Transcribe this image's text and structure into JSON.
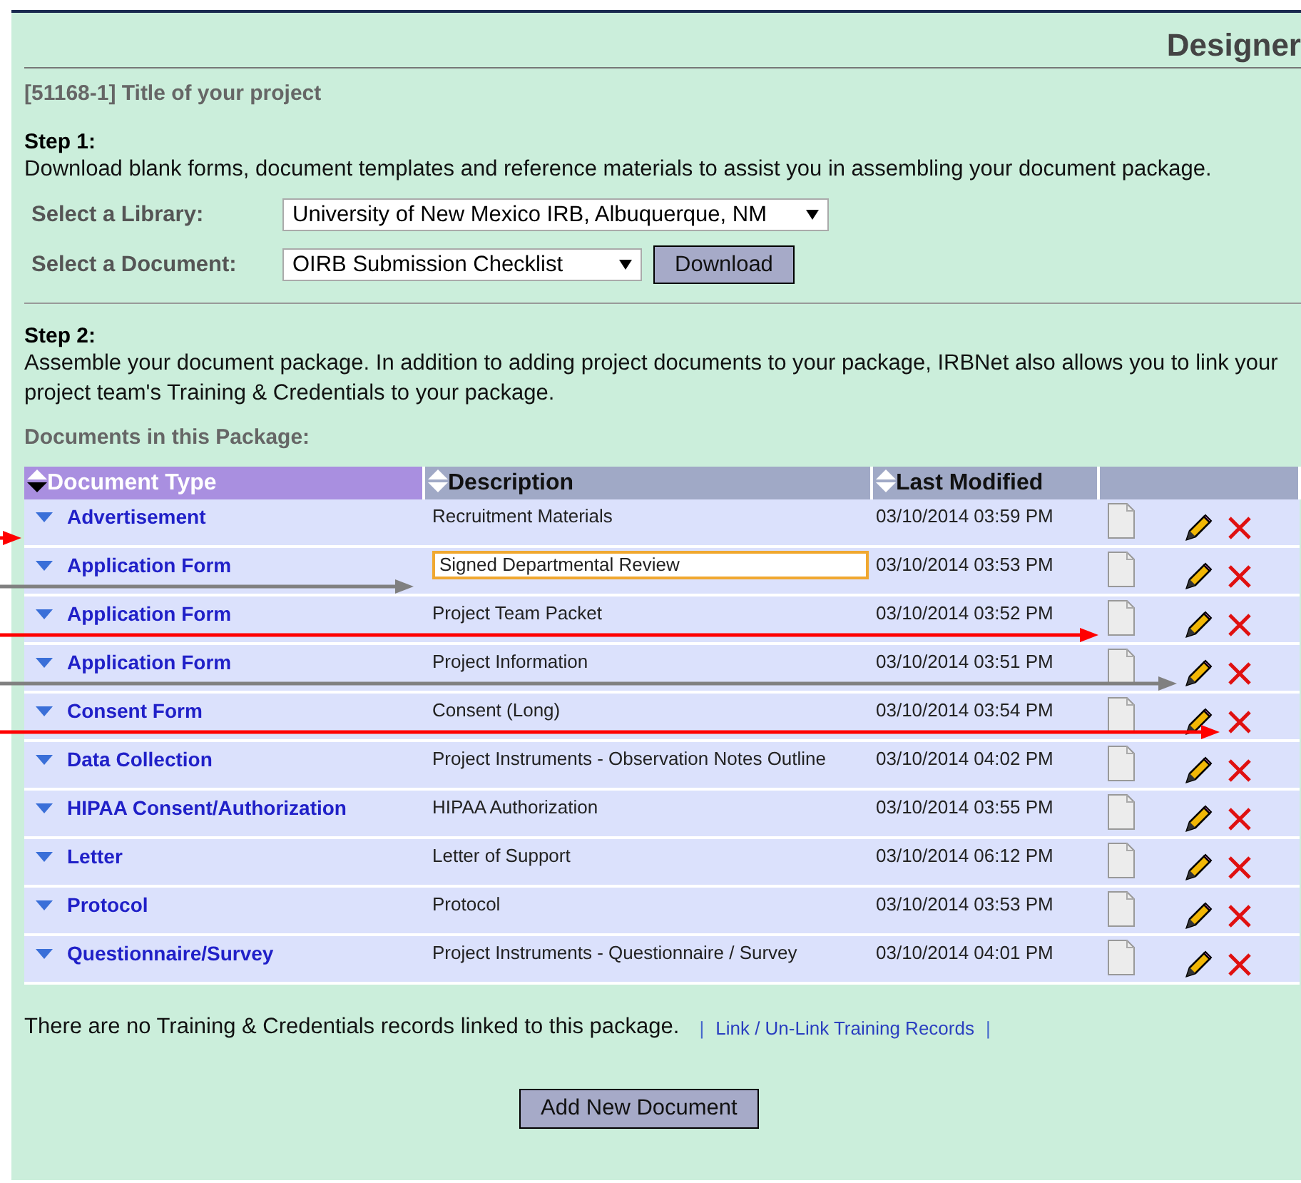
{
  "header": {
    "title": "Designer"
  },
  "project_title": "[51168-1] Title of your project",
  "step1": {
    "heading": "Step 1:",
    "text": "Download blank forms, document templates and reference materials to assist you in assembling your document package.",
    "library": {
      "label": "Select a Library:",
      "value": "University of New Mexico IRB, Albuquerque, NM"
    },
    "document": {
      "label": "Select a Document:",
      "value": "OIRB Submission Checklist"
    },
    "download_button": "Download"
  },
  "step2": {
    "heading": "Step 2:",
    "text": "Assemble your document package. In addition to adding project documents to your package, IRBNet also allows you to link your project team's Training & Credentials to your package."
  },
  "package_heading": "Documents in this Package:",
  "table": {
    "columns": [
      {
        "label": "Document Type",
        "sorted": true
      },
      {
        "label": "Description",
        "sorted": false
      },
      {
        "label": "Last Modified",
        "sorted": false
      }
    ],
    "rows": [
      {
        "type": "Advertisement",
        "description": "Recruitment Materials",
        "modified": "03/10/2014 03:59 PM",
        "editing": false,
        "arrow": {
          "color": "#ff0000",
          "kind": "type"
        }
      },
      {
        "type": "Application Form",
        "description": "Signed Departmental Review",
        "modified": "03/10/2014 03:53 PM",
        "editing": true,
        "arrow": {
          "color": "#808080",
          "kind": "description"
        }
      },
      {
        "type": "Application Form",
        "description": "Project Team Packet",
        "modified": "03/10/2014 03:52 PM",
        "editing": false,
        "arrow": {
          "color": "#ff0000",
          "kind": "file"
        }
      },
      {
        "type": "Application Form",
        "description": "Project Information",
        "modified": "03/10/2014 03:51 PM",
        "editing": false,
        "arrow": {
          "color": "#808080",
          "kind": "edit"
        }
      },
      {
        "type": "Consent Form",
        "description": "Consent (Long)",
        "modified": "03/10/2014 03:54 PM",
        "editing": false,
        "arrow": {
          "color": "#ff0000",
          "kind": "delete"
        }
      },
      {
        "type": "Data Collection",
        "description": "Project Instruments - Observation Notes Outline",
        "modified": "03/10/2014 04:02 PM",
        "editing": false
      },
      {
        "type": "HIPAA Consent/Authorization",
        "description": "HIPAA Authorization",
        "modified": "03/10/2014 03:55 PM",
        "editing": false
      },
      {
        "type": "Letter",
        "description": "Letter of Support",
        "modified": "03/10/2014 06:12 PM",
        "editing": false
      },
      {
        "type": "Protocol",
        "description": "Protocol",
        "modified": "03/10/2014 03:53 PM",
        "editing": false
      },
      {
        "type": "Questionnaire/Survey",
        "description": "Project Instruments - Questionnaire / Survey",
        "modified": "03/10/2014 04:01 PM",
        "editing": false
      }
    ]
  },
  "training": {
    "text": "There are no Training & Credentials records linked to this package.",
    "separator_left": "|",
    "link": "Link / Un-Link Training Records",
    "separator_right": "|"
  },
  "add_button": "Add New Document"
}
